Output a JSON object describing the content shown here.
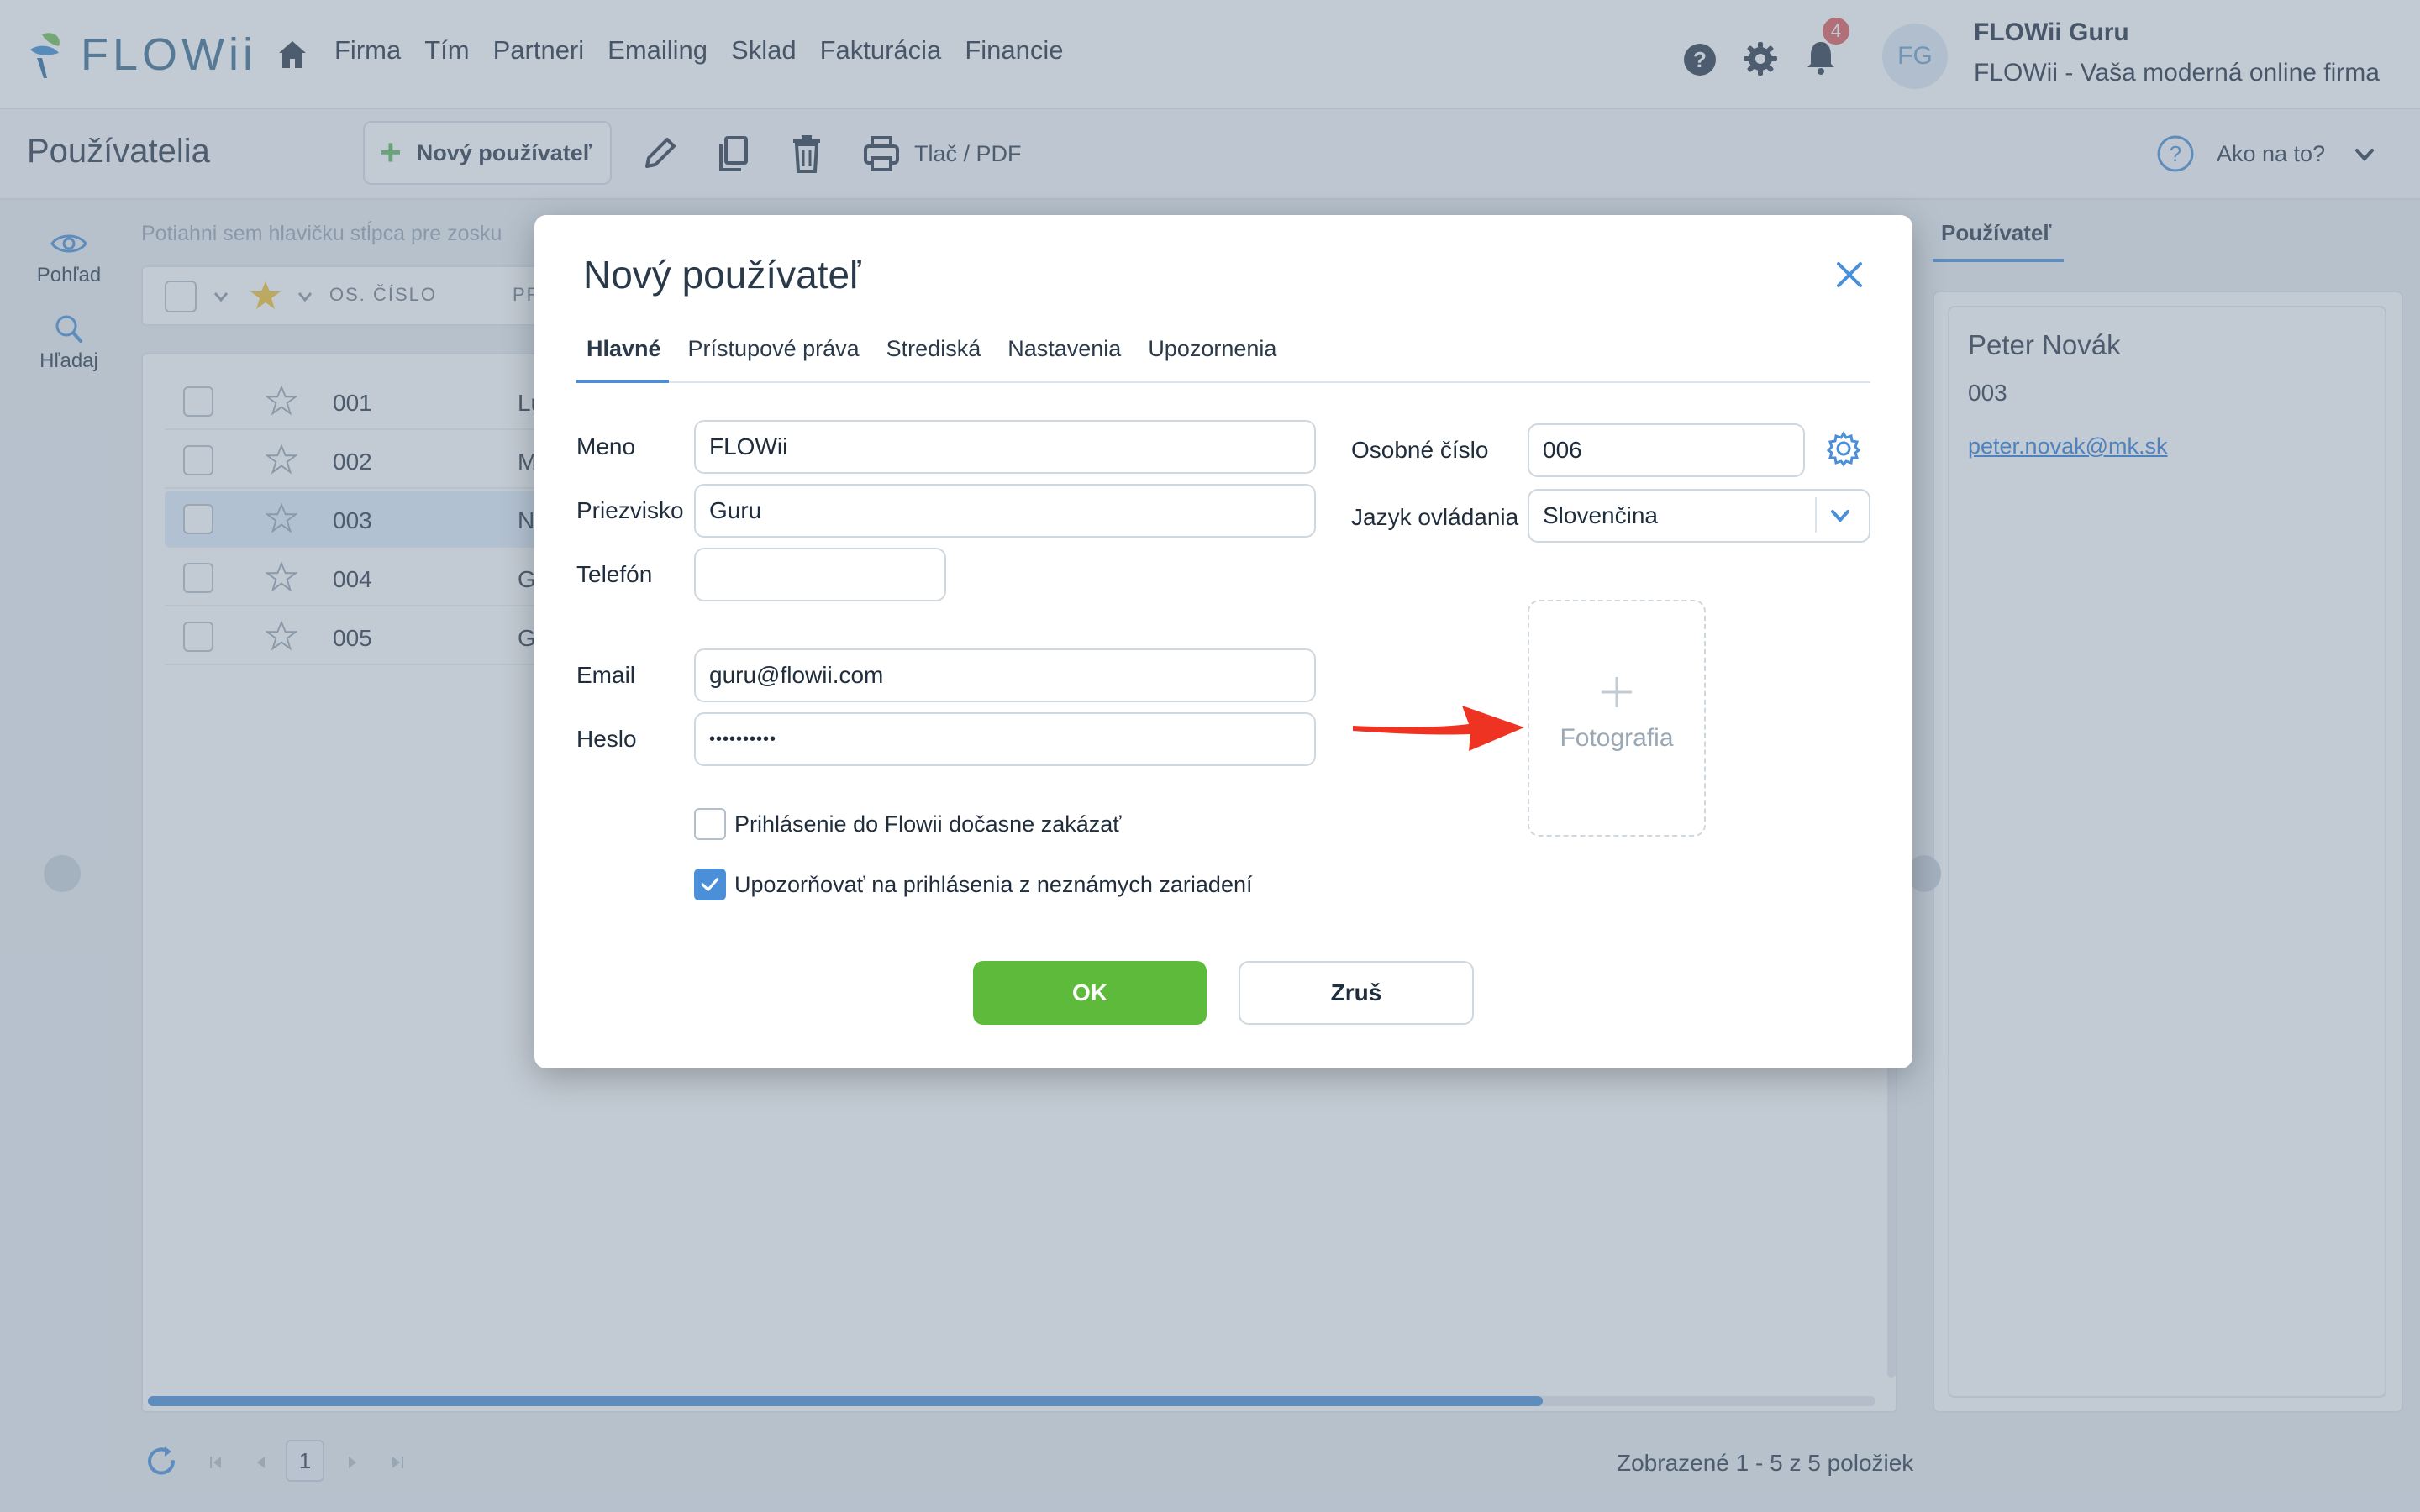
{
  "app": {
    "logo_text": "FLOWii",
    "nav": [
      "Firma",
      "Tím",
      "Partneri",
      "Emailing",
      "Sklad",
      "Fakturácia",
      "Financie"
    ],
    "notification_count": "4",
    "avatar_initials": "FG",
    "user_name": "FLOWii Guru",
    "company": "FLOWii - Vaša moderná online firma"
  },
  "toolbar": {
    "title": "Používatelia",
    "new_user": "Nový používateľ",
    "print": "Tlač / PDF",
    "howto": "Ako na to?"
  },
  "rail": {
    "view": "Pohľad",
    "search": "Hľadaj"
  },
  "grid": {
    "group_hint": "Potiahni sem hlavičku stĺpca pre zosku",
    "col_num": "OS. ČÍSLO",
    "col_trunc": "PR",
    "rows": [
      {
        "num": "001",
        "trunc": "Lu"
      },
      {
        "num": "002",
        "trunc": "M"
      },
      {
        "num": "003",
        "trunc": "N"
      },
      {
        "num": "004",
        "trunc": "G"
      },
      {
        "num": "005",
        "trunc": "G"
      }
    ],
    "page": "1",
    "status": "Zobrazené 1 - 5 z 5 položiek"
  },
  "right_panel": {
    "tab": "Používateľ",
    "name": "Peter Novák",
    "number": "003",
    "email": "peter.novak@mk.sk"
  },
  "modal": {
    "title": "Nový používateľ",
    "tabs": [
      "Hlavné",
      "Prístupové práva",
      "Strediská",
      "Nastavenia",
      "Upozornenia"
    ],
    "fields": {
      "meno_label": "Meno",
      "meno_value": "FLOWii",
      "priezvisko_label": "Priezvisko",
      "priezvisko_value": "Guru",
      "telefon_label": "Telefón",
      "telefon_value": "",
      "email_label": "Email",
      "email_value": "guru@flowii.com",
      "heslo_label": "Heslo",
      "heslo_value": "••••••••••",
      "osobne_label": "Osobné číslo",
      "osobne_value": "006",
      "jazyk_label": "Jazyk ovládania",
      "jazyk_value": "Slovenčina"
    },
    "photo_label": "Fotografia",
    "checkbox_disable": "Prihlásenie do Flowii dočasne zakázať",
    "checkbox_notify": "Upozorňovať na prihlásenia z neznámych zariadení",
    "ok": "OK",
    "cancel": "Zruš"
  }
}
